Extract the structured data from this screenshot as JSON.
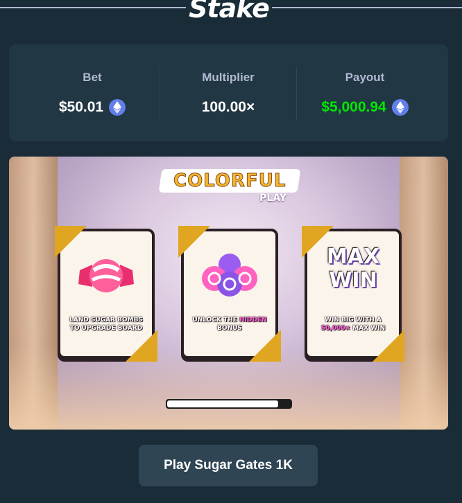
{
  "header": {
    "logo": "Stake"
  },
  "stats": {
    "bet_label": "Bet",
    "bet_value": "$50.01",
    "multiplier_label": "Multiplier",
    "multiplier_value": "100.00×",
    "payout_label": "Payout",
    "payout_value": "$5,000.94",
    "currency_icon": "ethereum-icon",
    "payout_color": "#00e701"
  },
  "banner": {
    "logo_main": "COLORFUL",
    "logo_sub": "PLAY",
    "cards": [
      {
        "icon": "candy-icon",
        "text_before": "LAND SUGAR BOMBS TO UPGRADE BOARD",
        "highlight": "",
        "text_after": ""
      },
      {
        "icon": "lollipops-icon",
        "text_before": "UNLOCK THE ",
        "highlight": "HIDDEN",
        "text_after": " BONUS"
      },
      {
        "icon": "max-win-icon",
        "title": "MAX WIN",
        "text_before": "WIN BIG WITH A ",
        "highlight": "50,000×",
        "text_after": " MAX WIN"
      }
    ],
    "progress": 0.9
  },
  "play_button": {
    "label": "Play Sugar Gates 1K"
  }
}
